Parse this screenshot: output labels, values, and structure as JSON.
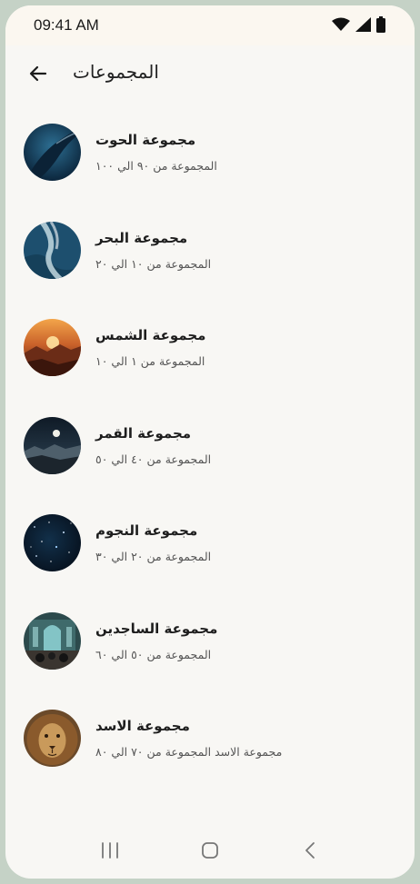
{
  "status_bar": {
    "time": "09:41 AM",
    "icons": [
      "wifi-icon",
      "cellular-signal-icon",
      "battery-icon"
    ]
  },
  "app_bar": {
    "back_icon": "arrow-left-icon",
    "title": "المجموعات"
  },
  "groups": [
    {
      "title": "مجموعة الحوت",
      "subtitle": "المجموعة من ٩٠ الي ١٠٠",
      "image": "whale"
    },
    {
      "title": "مجموعة البحر",
      "subtitle": "المجموعة من ١٠ الي ٢٠",
      "image": "sea"
    },
    {
      "title": "مجموعة الشمس",
      "subtitle": "المجموعة من ١ الي ١٠",
      "image": "sun"
    },
    {
      "title": "مجموعة القمر",
      "subtitle": "المجموعة من ٤٠ الي ٥٠",
      "image": "moon"
    },
    {
      "title": "مجموعة النجوم",
      "subtitle": "المجموعة من ٢٠ الي ٣٠",
      "image": "stars"
    },
    {
      "title": "مجموعة الساجدين",
      "subtitle": "المجموعة من ٥٠ الي ٦٠",
      "image": "mosque"
    },
    {
      "title": "مجموعة الاسد",
      "subtitle": "مجموعة الاسد المجموعة من ٧٠ الي ٨٠",
      "image": "lion"
    }
  ],
  "nav_bar": {
    "icons": [
      "recents-icon",
      "home-icon",
      "back-icon"
    ]
  }
}
